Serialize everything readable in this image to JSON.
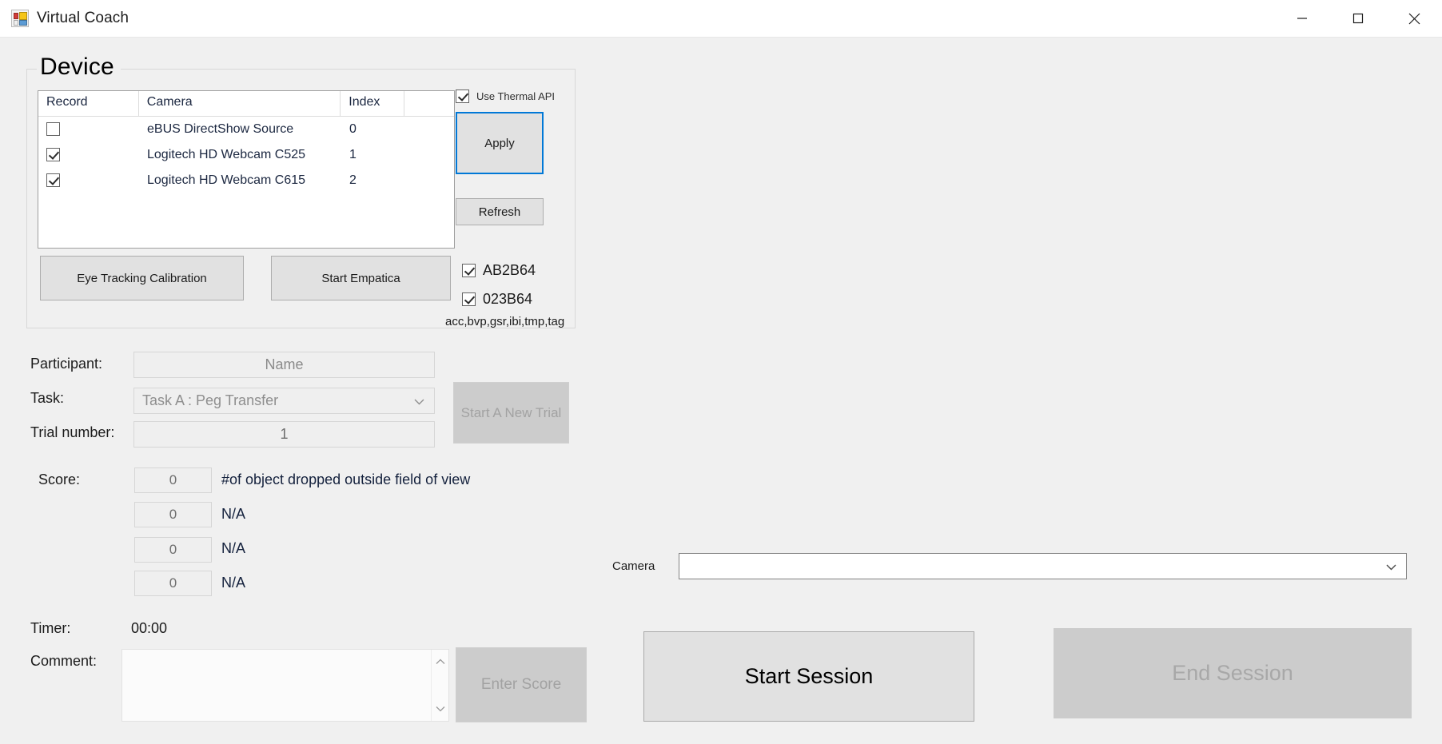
{
  "window": {
    "title": "Virtual Coach",
    "icon": "app-window-icon",
    "controls": {
      "minimize": "minimize-icon",
      "maximize": "maximize-icon",
      "close": "close-icon"
    }
  },
  "device_group": {
    "title": "Device",
    "camera_list": {
      "columns": [
        "Record",
        "Camera",
        "Index",
        ""
      ],
      "rows": [
        {
          "record_checked": false,
          "camera": "eBUS DirectShow Source",
          "index": "0"
        },
        {
          "record_checked": true,
          "camera": "Logitech HD Webcam C525",
          "index": "1"
        },
        {
          "record_checked": true,
          "camera": "Logitech HD Webcam C615",
          "index": "2"
        }
      ]
    },
    "use_thermal_api": {
      "label": "Use Thermal API",
      "checked": true
    },
    "apply_button": "Apply",
    "refresh_button": "Refresh",
    "eye_tracking_button": "Eye Tracking Calibration",
    "start_empatica_button": "Start Empatica",
    "empatica_devices": [
      {
        "label": "AB2B64",
        "checked": true
      },
      {
        "label": "023B64",
        "checked": true
      }
    ],
    "empatica_streams": "acc,bvp,gsr,ibi,tmp,tag"
  },
  "session_form": {
    "participant_label": "Participant:",
    "participant_placeholder": "Name",
    "participant_value": "",
    "task_label": "Task:",
    "task_selected": "Task A : Peg Transfer",
    "trial_label": "Trial number:",
    "trial_value": "1",
    "start_new_trial_button": "Start A New Trial"
  },
  "score_section": {
    "label": "Score:",
    "rows": [
      {
        "value": "0",
        "description": "#of object dropped outside field of view"
      },
      {
        "value": "0",
        "description": "N/A"
      },
      {
        "value": "0",
        "description": "N/A"
      },
      {
        "value": "0",
        "description": "N/A"
      }
    ]
  },
  "timer": {
    "label": "Timer:",
    "value": "00:00"
  },
  "comment": {
    "label": "Comment:",
    "value": "",
    "enter_score_button": "Enter Score"
  },
  "camera_preview": {
    "label": "Camera",
    "selected": ""
  },
  "session_controls": {
    "start_session": "Start Session",
    "end_session": "End Session"
  },
  "colors": {
    "window_background": "#f0f0f0",
    "titlebar": "#ffffff",
    "focus_accent": "#0078d7",
    "button_face": "#e1e1e1",
    "disabled_face": "#cccccc",
    "text": "#1b1b1b",
    "list_text": "#1b2740"
  }
}
